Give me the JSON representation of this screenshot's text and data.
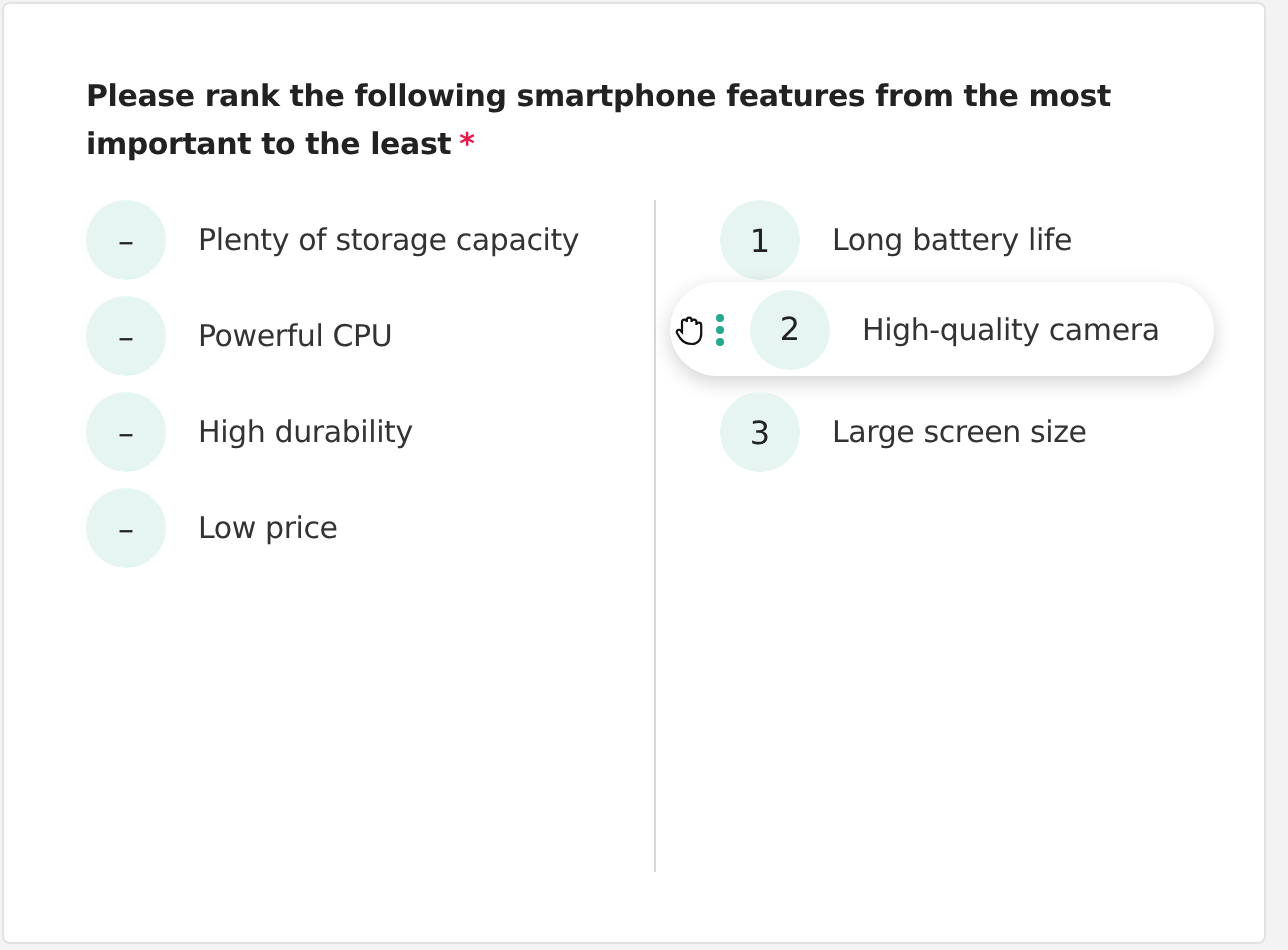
{
  "question": {
    "text": "Please rank the following smartphone features from the most important to the least",
    "required_mark": "*"
  },
  "unranked": [
    {
      "marker": "–",
      "label": "Plenty of storage capacity"
    },
    {
      "marker": "–",
      "label": "Powerful CPU"
    },
    {
      "marker": "–",
      "label": "High durability"
    },
    {
      "marker": "–",
      "label": "Low price"
    }
  ],
  "ranked": [
    {
      "rank": "1",
      "label": "Long battery life",
      "dragging": false
    },
    {
      "rank": "2",
      "label": "High-quality camera",
      "dragging": true
    },
    {
      "rank": "3",
      "label": "Large screen size",
      "dragging": false
    }
  ]
}
